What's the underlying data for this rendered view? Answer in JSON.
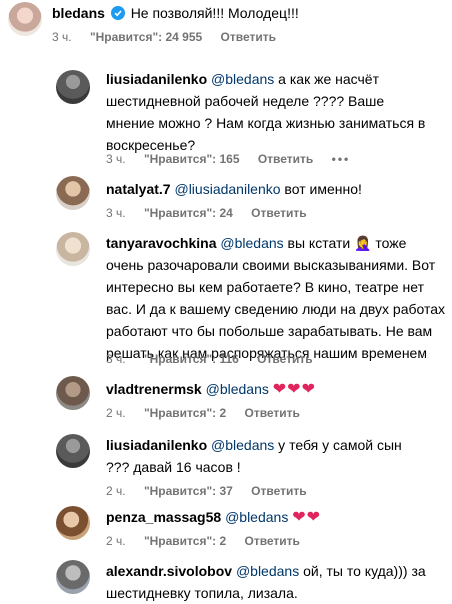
{
  "top": {
    "username": "bledans",
    "text": "Не позволяй!!! Молодец!!!",
    "time": "3 ч.",
    "likes": "\"Нравится\": 24 955",
    "reply": "Ответить"
  },
  "replies": [
    {
      "username": "liusiadanilenko",
      "mention": "@bledans",
      "text": " а как же насчёт шестидневной рабочей неделе ???? Ваше мнение можно ? Нам когда жизнью заниматься в воскресенье?",
      "time": "3 ч.",
      "likes": "\"Нравится\": 165",
      "reply": "Ответить",
      "more": "•••"
    },
    {
      "username": "natalyat.7",
      "mention": "@liusiadanilenko",
      "text": " вот именно!",
      "time": "3 ч.",
      "likes": "\"Нравится\": 24",
      "reply": "Ответить"
    },
    {
      "username": "tanyaravochkina",
      "mention": "@bledans",
      "text": " вы кстати 🤦‍♀️ тоже очень разочаровали своими высказываниями. Вот интересно вы кем работаете? В кино, театре нет вас. И да к вашему сведению люди на двух работах работают что бы побольше зарабатывать. Не вам решать как нам распоряжаться нашим временем",
      "time": "3 ч.",
      "likes": "\"Нравится\": 116",
      "reply": "Ответить"
    },
    {
      "username": "vladtrenermsk",
      "mention": "@bledans",
      "text": "",
      "hearts": "❤❤❤",
      "time": "2 ч.",
      "likes": "\"Нравится\": 2",
      "reply": "Ответить"
    },
    {
      "username": "liusiadanilenko",
      "mention": "@bledans",
      "text": " у тебя у самой сын ??? давай 16 часов !",
      "time": "2 ч.",
      "likes": "\"Нравится\": 37",
      "reply": "Ответить"
    },
    {
      "username": "penza_massag58",
      "mention": "@bledans",
      "text": "",
      "hearts": "❤❤",
      "time": "2 ч.",
      "likes": "\"Нравится\": 2",
      "reply": "Ответить"
    },
    {
      "username": "alexandr.sivolobov",
      "mention": "@bledans",
      "text": " ой, ты то куда))) за шестидневку топила, лизала.",
      "time": "",
      "likes": "",
      "reply": ""
    }
  ],
  "colors": {
    "accent_link": "#00376b",
    "verified": "#1d9bf0",
    "meta": "#737373",
    "heart": "#e0245e"
  }
}
